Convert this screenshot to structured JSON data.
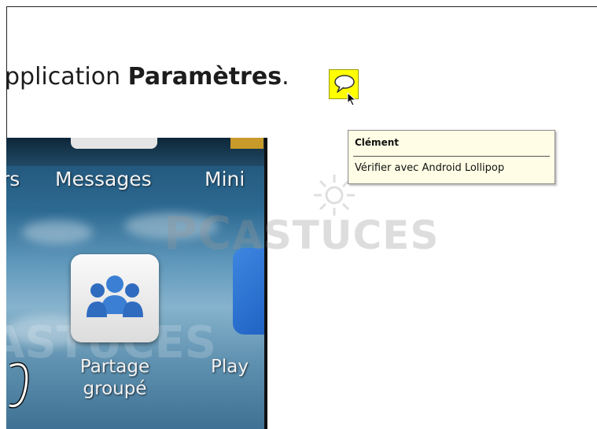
{
  "document": {
    "text_before": "pplication ",
    "text_bold": "Paramètres",
    "text_after": "."
  },
  "comment": {
    "author": "Clément",
    "text": "Vérifier avec Android Lollipop"
  },
  "phone": {
    "tabs": [
      "rs",
      "Messages",
      "Mini"
    ],
    "app_label_line1": "Partage",
    "app_label_line2": "groupé",
    "next_app_label": "Play"
  },
  "watermark": {
    "pc": "PC",
    "astuces": "ASTUCES"
  },
  "colors": {
    "comment_marker": "#ffff00",
    "tooltip_bg": "#fffde5"
  },
  "icons": [
    "comment-bubble-icon",
    "mouse-cursor-icon",
    "group-share-icon"
  ]
}
